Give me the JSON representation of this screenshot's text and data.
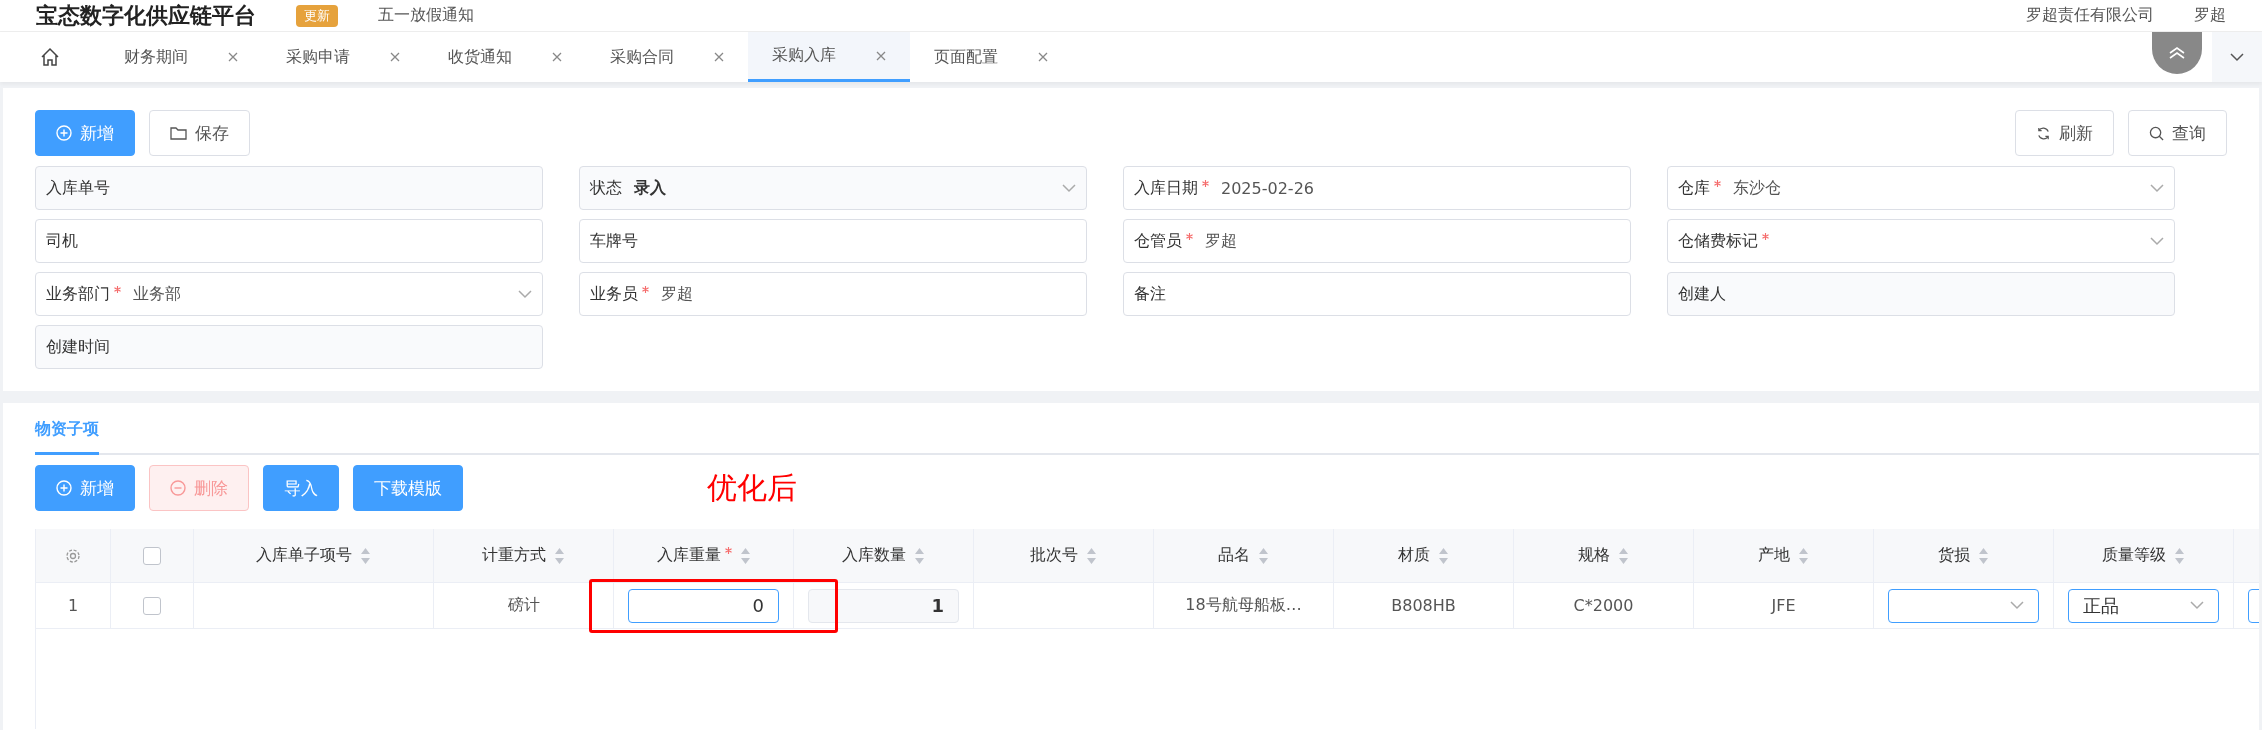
{
  "header": {
    "title": "宝态数字化供应链平台",
    "badge": "更新",
    "notice": "五一放假通知",
    "company": "罗超责任有限公司",
    "user": "罗超"
  },
  "tabs": [
    {
      "label": "财务期间",
      "selected": false
    },
    {
      "label": "采购申请",
      "selected": false
    },
    {
      "label": "收货通知",
      "selected": false
    },
    {
      "label": "采购合同",
      "selected": false
    },
    {
      "label": "采购入库",
      "selected": true
    },
    {
      "label": "页面配置",
      "selected": false
    }
  ],
  "toolbar": {
    "left": [
      {
        "label": "新增",
        "kind": "primary"
      },
      {
        "label": "保存",
        "kind": "plain"
      }
    ],
    "right": [
      {
        "label": "刷新",
        "kind": "refresh"
      },
      {
        "label": "查询",
        "kind": "search"
      }
    ]
  },
  "form": [
    {
      "label": "入库单号",
      "required": false,
      "kind": "readonly"
    },
    {
      "label": "状态",
      "required": false,
      "value": "录入",
      "kind": "status"
    },
    {
      "label": "入库日期",
      "required": true,
      "value": "2025-02-26",
      "kind": "input"
    },
    {
      "label": "仓库",
      "required": true,
      "value": "东沙仓",
      "kind": "select"
    },
    {
      "label": "司机",
      "required": false,
      "kind": "input"
    },
    {
      "label": "车牌号",
      "required": false,
      "kind": "input"
    },
    {
      "label": "仓管员",
      "required": true,
      "value": "罗超",
      "kind": "input"
    },
    {
      "label": "仓储费标记",
      "required": true,
      "kind": "select"
    },
    {
      "label": "业务部门",
      "required": true,
      "value": "业务部",
      "kind": "select"
    },
    {
      "label": "业务员",
      "required": true,
      "value": "罗超",
      "kind": "input"
    },
    {
      "label": "备注",
      "required": false,
      "kind": "input"
    },
    {
      "label": "创建人",
      "required": false,
      "kind": "readonly"
    },
    {
      "label": "创建时间",
      "required": false,
      "kind": "readonly"
    }
  ],
  "section": {
    "tab": "物资子项",
    "buttons": [
      {
        "label": "新增",
        "kind": "add"
      },
      {
        "label": "删除",
        "kind": "delete",
        "disabled": true
      },
      {
        "label": "导入",
        "kind": "primary"
      },
      {
        "label": "下载模版",
        "kind": "primary"
      }
    ],
    "annotation": "优化后"
  },
  "table": {
    "all_checked": false,
    "columns": [
      {
        "label": "入库单子项号",
        "required": false
      },
      {
        "label": "计重方式",
        "required": false
      },
      {
        "label": "入库重量",
        "required": true
      },
      {
        "label": "入库数量",
        "required": false
      },
      {
        "label": "批次号",
        "required": false
      },
      {
        "label": "品名",
        "required": false
      },
      {
        "label": "材质",
        "required": false
      },
      {
        "label": "规格",
        "required": false
      },
      {
        "label": "产地",
        "required": false
      },
      {
        "label": "货损",
        "required": false
      },
      {
        "label": "质量等级",
        "required": false
      }
    ],
    "rows": [
      {
        "index": "1",
        "checked": false,
        "cells": [
          {
            "kind": "text"
          },
          {
            "kind": "text",
            "value": "磅计"
          },
          {
            "kind": "input",
            "value": "0"
          },
          {
            "kind": "readonly",
            "value": "1"
          },
          {
            "kind": "text"
          },
          {
            "kind": "text",
            "value": "18号航母船板…"
          },
          {
            "kind": "text",
            "value": "B808HB"
          },
          {
            "kind": "text",
            "value": "C*2000"
          },
          {
            "kind": "text",
            "value": "JFE"
          },
          {
            "kind": "select"
          },
          {
            "kind": "select",
            "value": "正品"
          }
        ]
      }
    ]
  }
}
